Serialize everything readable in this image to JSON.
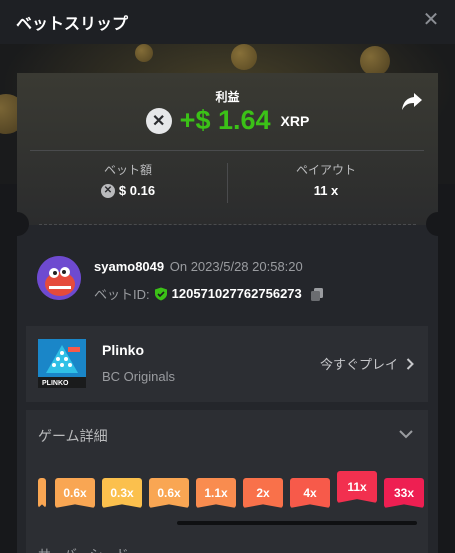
{
  "header": {
    "title": "ベットスリップ"
  },
  "profit": {
    "label": "利益",
    "amount": "+$ 1.64",
    "currency": "XRP",
    "currency_icon": "xrp-icon",
    "amount_color": "#3bc117"
  },
  "stats": {
    "bet_amount_label": "ベット額",
    "bet_amount_value": "$ 0.16",
    "payout_label": "ペイアウト",
    "payout_value": "11 x"
  },
  "bet": {
    "username": "syamo8049",
    "date": "On 2023/5/28 20:58:20",
    "bet_id_label": "ベットID:",
    "bet_id_value": "120571027762756273"
  },
  "game": {
    "name": "Plinko",
    "provider": "BC Originals",
    "play_label": "今すぐプレイ",
    "thumb_label": "PLINKO"
  },
  "details": {
    "title": "ゲーム詳細",
    "multipliers": [
      "0.6x",
      "0.3x",
      "0.6x",
      "1.1x",
      "2x",
      "4x",
      "11x",
      "33x"
    ],
    "multiplier_colors": [
      "#f9a653",
      "#fbc04d",
      "#f9a653",
      "#f98c4f",
      "#f9714a",
      "#f75a4a",
      "#f2304f",
      "#ee1f52"
    ],
    "highlighted": "11x",
    "bottom_label": "サーバーシード"
  }
}
